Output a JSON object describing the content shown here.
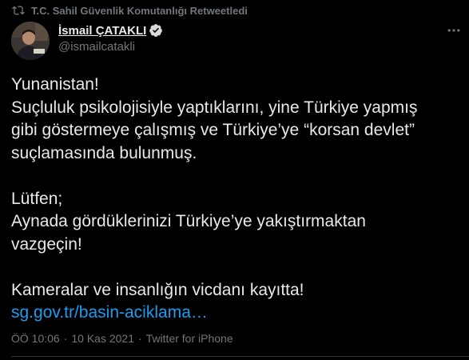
{
  "retweet": {
    "icon": "retweet-icon",
    "text": "T.C. Sahil Güvenlik Komutanlığı Retweetledi"
  },
  "author": {
    "display_name": "İsmail ÇATAKLI",
    "handle": "@ismailcatakli",
    "verified_icon": "verified-badge-icon",
    "avatar_icon": "profile-avatar"
  },
  "more_icon": "more-options-icon",
  "tweet": {
    "lines_p1": [
      "Yunanistan!",
      "Suçluluk psikolojisiyle yaptıklarını, yine Türkiye yapmış",
      "gibi göstermeye çalışmış ve Türkiye’ye “korsan devlet”",
      "suçlamasında bulunmuş."
    ],
    "lines_p2": [
      "Lütfen;",
      "Aynada gördüklerinizi Türkiye’ye yakıştırmaktan",
      "vazgeçin!"
    ],
    "lines_p3": [
      "Kameralar ve insanlığın vicdanı kayıtta!"
    ],
    "link": "sg.gov.tr/basin-aciklama…"
  },
  "meta": {
    "time": "ÖÖ 10:06",
    "separator1": "·",
    "date": "10 Kas 2021",
    "separator2": "·",
    "source": "Twitter for iPhone"
  },
  "colors": {
    "background": "#000000",
    "text": "#e7e9ea",
    "secondary": "#71767b",
    "link": "#1d9bf0",
    "verified": "#d9d9d9"
  }
}
